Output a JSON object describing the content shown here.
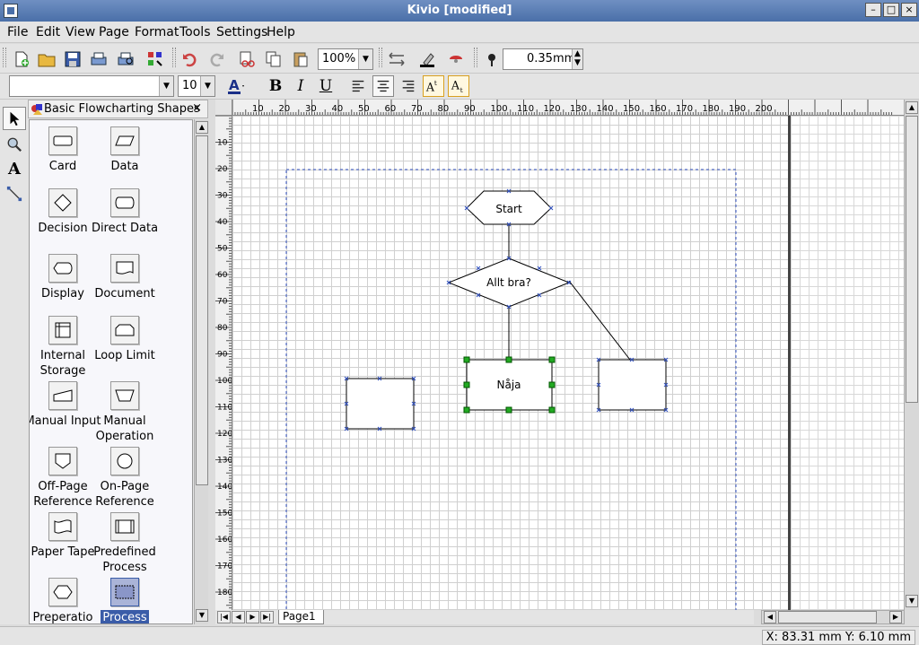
{
  "window": {
    "title": "Kivio [modified]"
  },
  "menu": [
    "File",
    "Edit",
    "View",
    "Page",
    "Format",
    "Tools",
    "Settings",
    "Help"
  ],
  "toolbar": {
    "zoom": "100%",
    "line_width": "0.35mm"
  },
  "format_toolbar": {
    "font_name": "",
    "font_size": "10",
    "bold": "B",
    "italic": "I",
    "underline": "U"
  },
  "stencil": {
    "title": "Basic Flowcharting Shapes",
    "close": "×",
    "shapes": [
      {
        "label": "Card",
        "icon": "card-icon"
      },
      {
        "label": "Data",
        "icon": "data-icon"
      },
      {
        "label": "Decision",
        "icon": "decision-icon"
      },
      {
        "label": "Direct Data",
        "icon": "direct-data-icon"
      },
      {
        "label": "Display",
        "icon": "display-icon"
      },
      {
        "label": "Document",
        "icon": "document-icon"
      },
      {
        "label": "Internal Storage",
        "icon": "internal-storage-icon"
      },
      {
        "label": "Loop Limit",
        "icon": "loop-limit-icon"
      },
      {
        "label": "Manual Input",
        "icon": "manual-input-icon"
      },
      {
        "label": "Manual Operation",
        "icon": "manual-operation-icon"
      },
      {
        "label": "Off-Page Reference",
        "icon": "off-page-reference-icon"
      },
      {
        "label": "On-Page Reference",
        "icon": "on-page-reference-icon"
      },
      {
        "label": "Paper Tape",
        "icon": "paper-tape-icon"
      },
      {
        "label": "Predefined Process",
        "icon": "predefined-process-icon"
      },
      {
        "label": "Preperatio",
        "icon": "preparation-icon"
      },
      {
        "label": "Process",
        "icon": "process-icon",
        "selected": true
      }
    ]
  },
  "rulers": {
    "horizontal": [
      "10",
      "20",
      "30",
      "40",
      "50",
      "60",
      "70",
      "80",
      "90",
      "100",
      "110",
      "120",
      "130",
      "140",
      "150",
      "160",
      "170",
      "180",
      "190",
      "200"
    ],
    "vertical": [
      "10",
      "20",
      "30",
      "40",
      "50",
      "60",
      "70",
      "80",
      "90",
      "100",
      "110",
      "120",
      "130",
      "140",
      "150",
      "160",
      "170",
      "180"
    ]
  },
  "diagram": {
    "start": "Start",
    "decision": "Allt bra?",
    "process_selected": "Nåja"
  },
  "pages": [
    "Page1"
  ],
  "status": {
    "coords": "X: 83.31 mm Y: 6.10 mm"
  }
}
